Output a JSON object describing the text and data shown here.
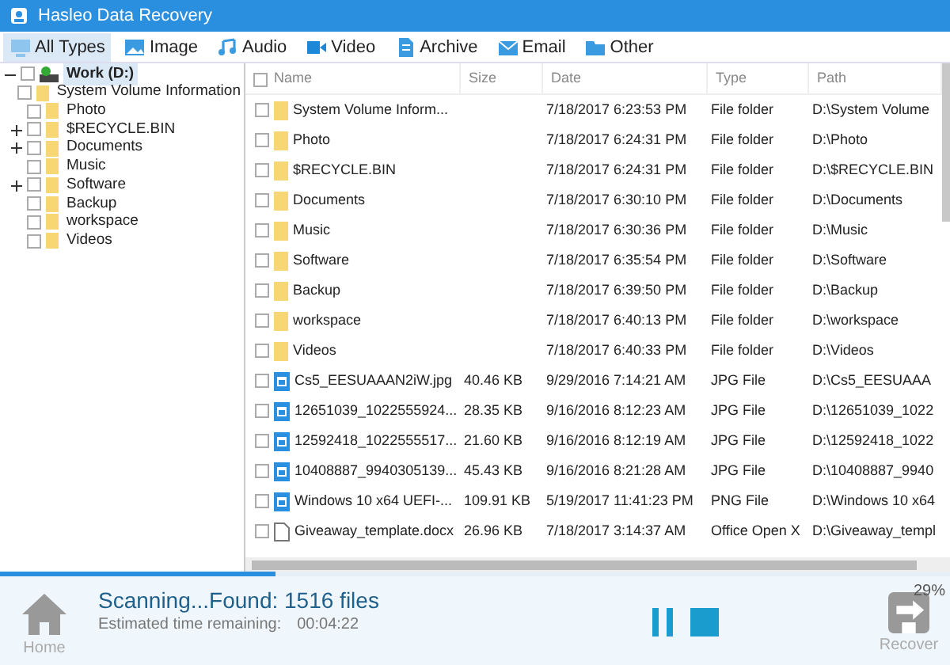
{
  "window": {
    "title": "Hasleo Data Recovery"
  },
  "tabs": [
    {
      "label": "All Types",
      "kind": "all",
      "selected": true
    },
    {
      "label": "Image",
      "kind": "image",
      "selected": false
    },
    {
      "label": "Audio",
      "kind": "audio",
      "selected": false
    },
    {
      "label": "Video",
      "kind": "video",
      "selected": false
    },
    {
      "label": "Archive",
      "kind": "archive",
      "selected": false
    },
    {
      "label": "Email",
      "kind": "email",
      "selected": false
    },
    {
      "label": "Other",
      "kind": "other",
      "selected": false
    }
  ],
  "tree": {
    "label": "Work (D:)",
    "checked": false,
    "expanded": true,
    "selected": true,
    "children": [
      {
        "label": "System Volume Information",
        "checked": false,
        "expandable": false
      },
      {
        "label": "Photo",
        "checked": false,
        "expandable": false
      },
      {
        "label": "$RECYCLE.BIN",
        "checked": false,
        "expandable": true
      },
      {
        "label": "Documents",
        "checked": false,
        "expandable": true
      },
      {
        "label": "Music",
        "checked": false,
        "expandable": false
      },
      {
        "label": "Software",
        "checked": false,
        "expandable": true
      },
      {
        "label": "Backup",
        "checked": false,
        "expandable": false
      },
      {
        "label": "workspace",
        "checked": false,
        "expandable": false
      },
      {
        "label": "Videos",
        "checked": false,
        "expandable": false
      }
    ]
  },
  "table": {
    "columns": [
      "Name",
      "Size",
      "Date",
      "Type",
      "Path"
    ],
    "header_checked": false,
    "rows": [
      {
        "kind": "folder",
        "checked": false,
        "cells": [
          "System Volume Inform...",
          "",
          "7/18/2017 6:23:53 PM",
          "File folder",
          "D:\\System Volume"
        ]
      },
      {
        "kind": "folder",
        "checked": false,
        "cells": [
          "Photo",
          "",
          "7/18/2017 6:24:31 PM",
          "File folder",
          "D:\\Photo"
        ]
      },
      {
        "kind": "folder",
        "checked": false,
        "cells": [
          "$RECYCLE.BIN",
          "",
          "7/18/2017 6:24:31 PM",
          "File folder",
          "D:\\$RECYCLE.BIN"
        ]
      },
      {
        "kind": "folder",
        "checked": false,
        "cells": [
          "Documents",
          "",
          "7/18/2017 6:30:10 PM",
          "File folder",
          "D:\\Documents"
        ]
      },
      {
        "kind": "folder",
        "checked": false,
        "cells": [
          "Music",
          "",
          "7/18/2017 6:30:36 PM",
          "File folder",
          "D:\\Music"
        ]
      },
      {
        "kind": "folder",
        "checked": false,
        "cells": [
          "Software",
          "",
          "7/18/2017 6:35:54 PM",
          "File folder",
          "D:\\Software"
        ]
      },
      {
        "kind": "folder",
        "checked": false,
        "cells": [
          "Backup",
          "",
          "7/18/2017 6:39:50 PM",
          "File folder",
          "D:\\Backup"
        ]
      },
      {
        "kind": "folder",
        "checked": false,
        "cells": [
          "workspace",
          "",
          "7/18/2017 6:40:13 PM",
          "File folder",
          "D:\\workspace"
        ]
      },
      {
        "kind": "folder",
        "checked": false,
        "cells": [
          "Videos",
          "",
          "7/18/2017 6:40:33 PM",
          "File folder",
          "D:\\Videos"
        ]
      },
      {
        "kind": "image",
        "checked": false,
        "cells": [
          "Cs5_EESUAAAN2iW.jpg",
          "40.46 KB",
          "9/29/2016 7:14:21 AM",
          "JPG File",
          "D:\\Cs5_EESUAAA"
        ]
      },
      {
        "kind": "image",
        "checked": false,
        "cells": [
          "12651039_1022555924...",
          "28.35 KB",
          "9/16/2016 8:12:23 AM",
          "JPG File",
          "D:\\12651039_1022"
        ]
      },
      {
        "kind": "image",
        "checked": false,
        "cells": [
          "12592418_1022555517...",
          "21.60 KB",
          "9/16/2016 8:12:19 AM",
          "JPG File",
          "D:\\12592418_1022"
        ]
      },
      {
        "kind": "image",
        "checked": false,
        "cells": [
          "10408887_9940305139...",
          "45.43 KB",
          "9/16/2016 8:21:28 AM",
          "JPG File",
          "D:\\10408887_9940"
        ]
      },
      {
        "kind": "image",
        "checked": false,
        "cells": [
          "Windows 10 x64 UEFI-...",
          "109.91 KB",
          "5/19/2017 11:41:23 PM",
          "PNG File",
          "D:\\Windows 10 x64"
        ]
      },
      {
        "kind": "document",
        "checked": false,
        "cells": [
          "Giveaway_template.docx",
          "26.96 KB",
          "7/18/2017 3:14:37 AM",
          "Office Open X",
          "D:\\Giveaway_templ"
        ]
      }
    ]
  },
  "progress": {
    "level": 0.29,
    "reading": "29%"
  },
  "status": {
    "headline": "Scanning...Found: 1516 files",
    "eta_label": "Estimated time remaining:",
    "eta": "00:04:22"
  },
  "buttons": {
    "home": {
      "label": "Home",
      "disabled": true
    },
    "recover": {
      "label": "Recover",
      "disabled": true
    }
  }
}
